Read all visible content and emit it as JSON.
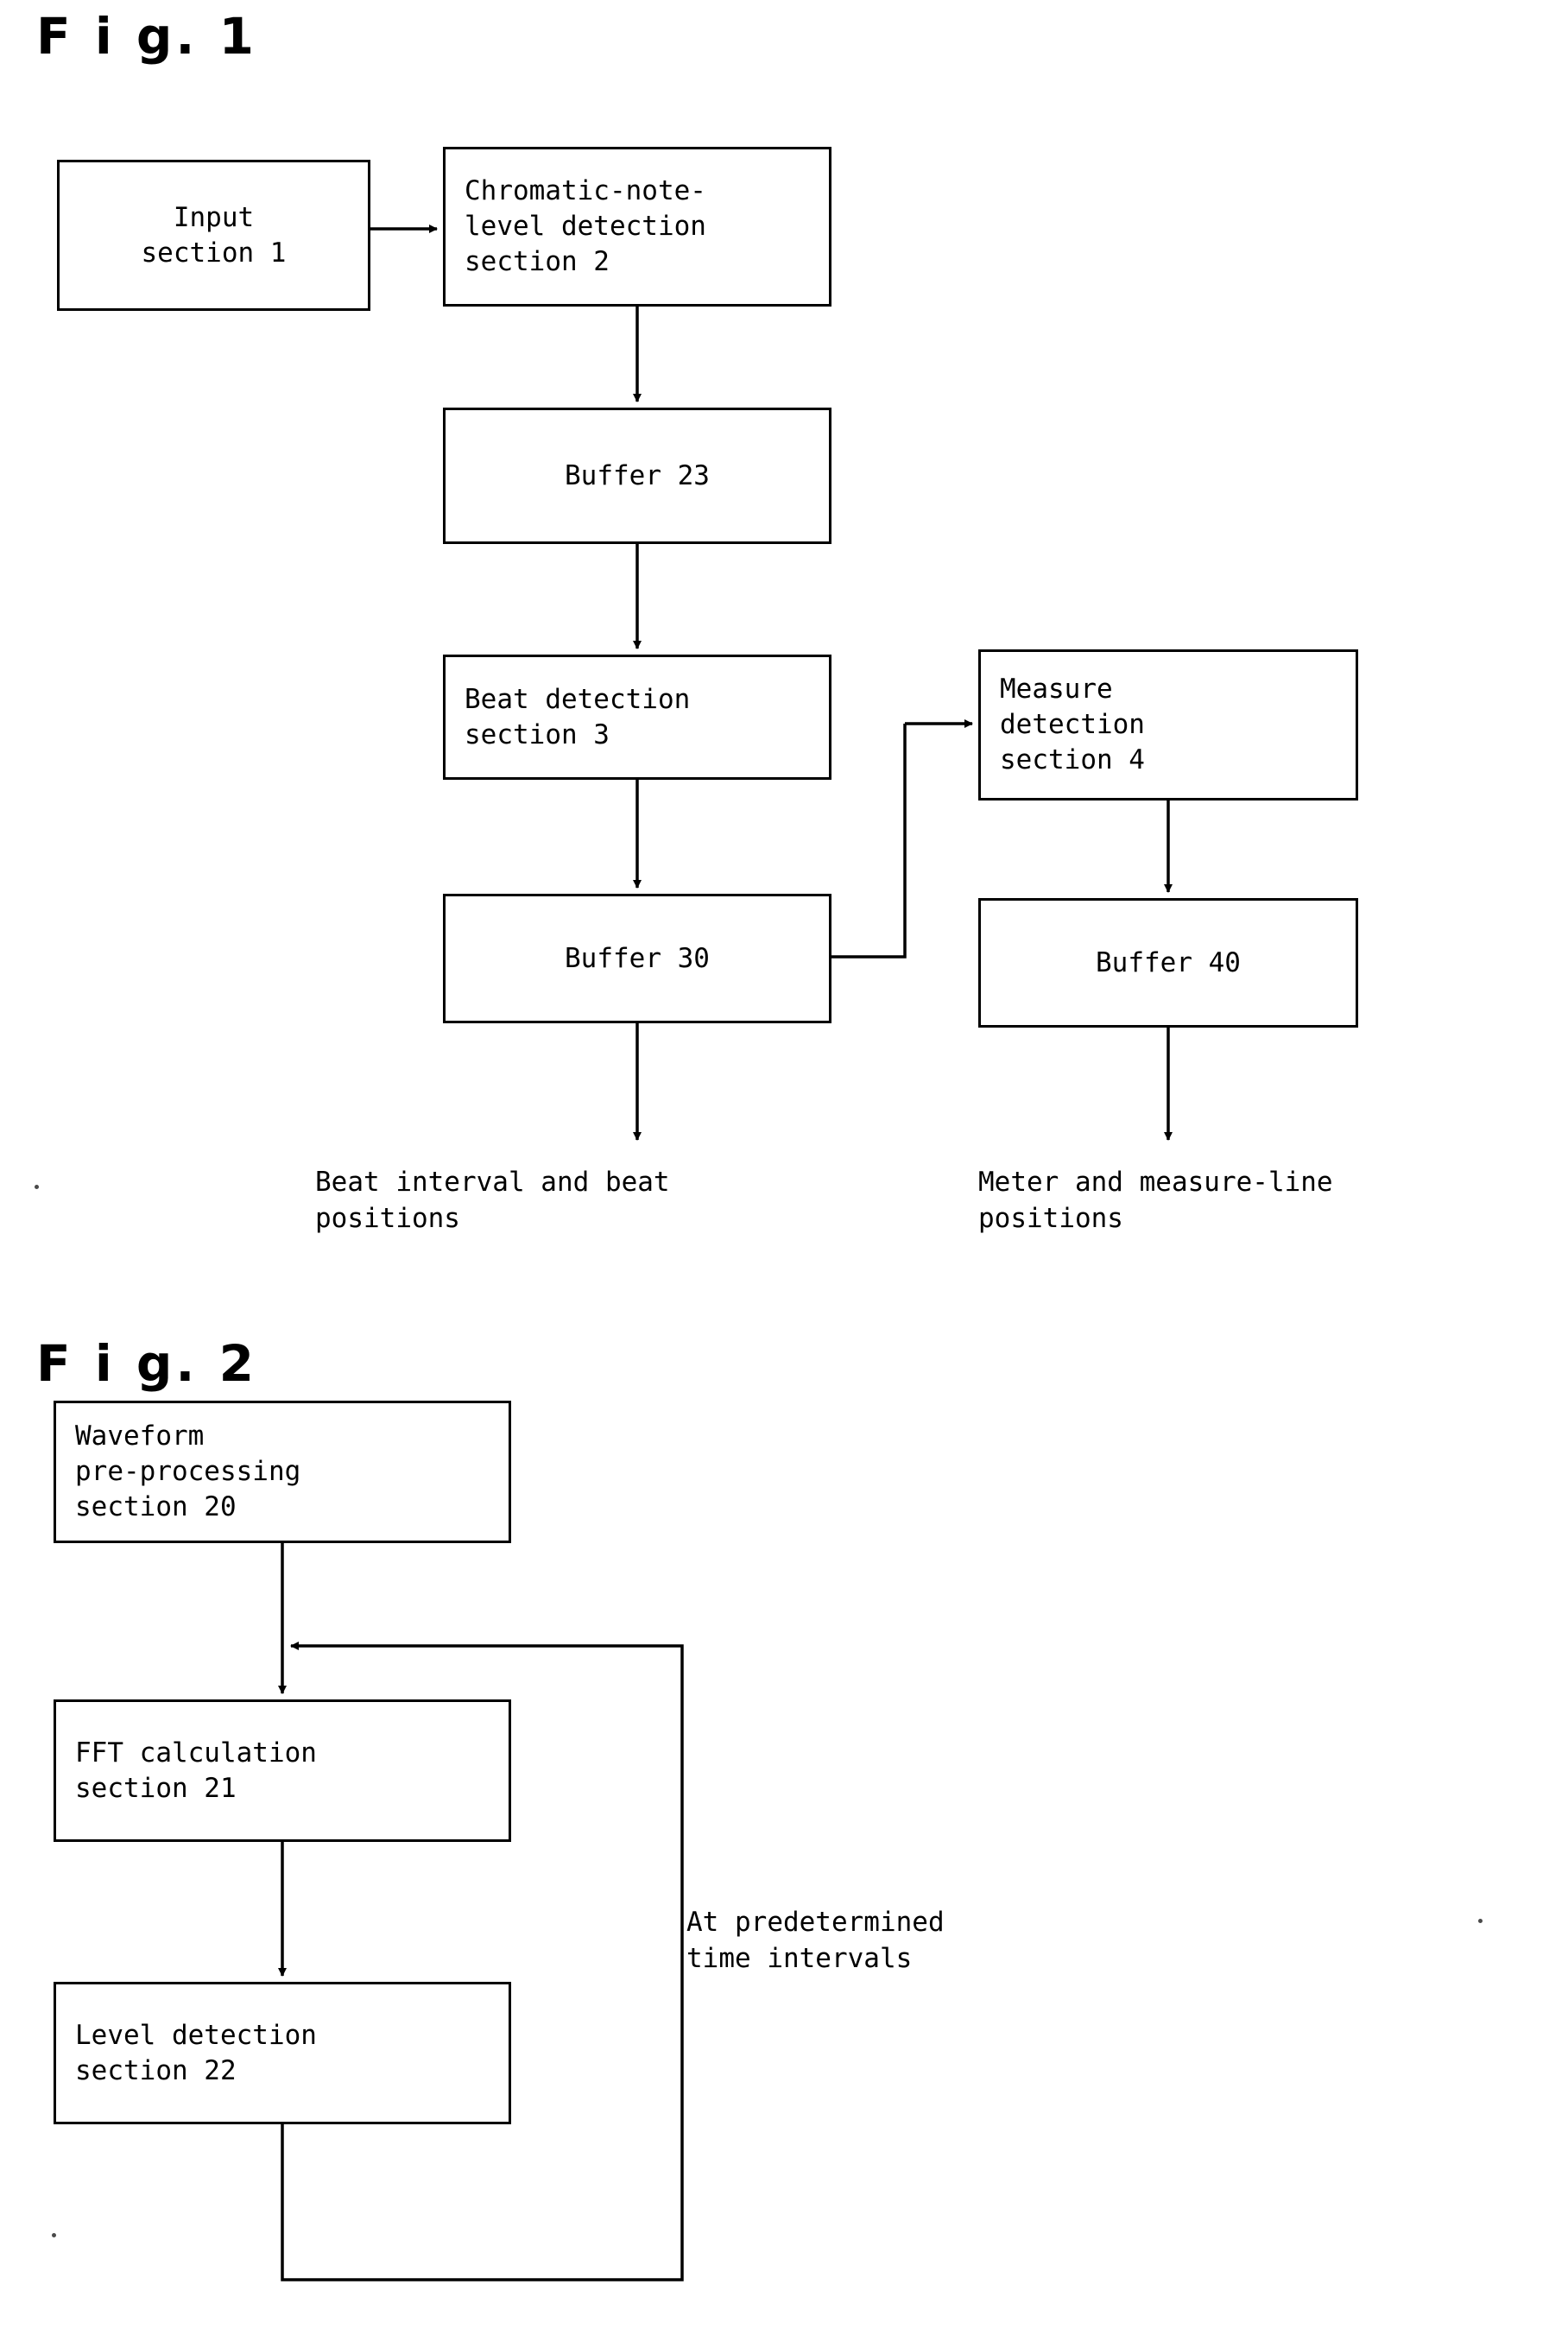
{
  "figures": [
    {
      "label": "F i g. 1",
      "boxes": [
        {
          "name": "input-section-box",
          "text": "Input\nsection 1"
        },
        {
          "name": "chromatic-note-level-detection-box",
          "text": "Chromatic-note-\nlevel detection\nsection 2"
        },
        {
          "name": "buffer-23-box",
          "text": "Buffer 23"
        },
        {
          "name": "beat-detection-section-box",
          "text": "Beat detection\nsection 3"
        },
        {
          "name": "buffer-30-box",
          "text": "Buffer 30"
        },
        {
          "name": "measure-detection-section-box",
          "text": "Measure\ndetection\nsection 4"
        },
        {
          "name": "buffer-40-box",
          "text": "Buffer 40"
        }
      ],
      "captions": [
        {
          "name": "beat-output-caption",
          "text": "Beat interval and beat\npositions"
        },
        {
          "name": "meter-output-caption",
          "text": "Meter and measure-line\npositions"
        }
      ]
    },
    {
      "label": "F i g. 2",
      "boxes": [
        {
          "name": "waveform-pre-processing-box",
          "text": "Waveform\npre-processing\nsection 20"
        },
        {
          "name": "fft-calculation-box",
          "text": "FFT calculation\nsection 21"
        },
        {
          "name": "level-detection-box",
          "text": "Level detection\nsection 22"
        }
      ],
      "captions": [
        {
          "name": "time-interval-caption",
          "text": "At predetermined\ntime intervals"
        }
      ]
    }
  ]
}
